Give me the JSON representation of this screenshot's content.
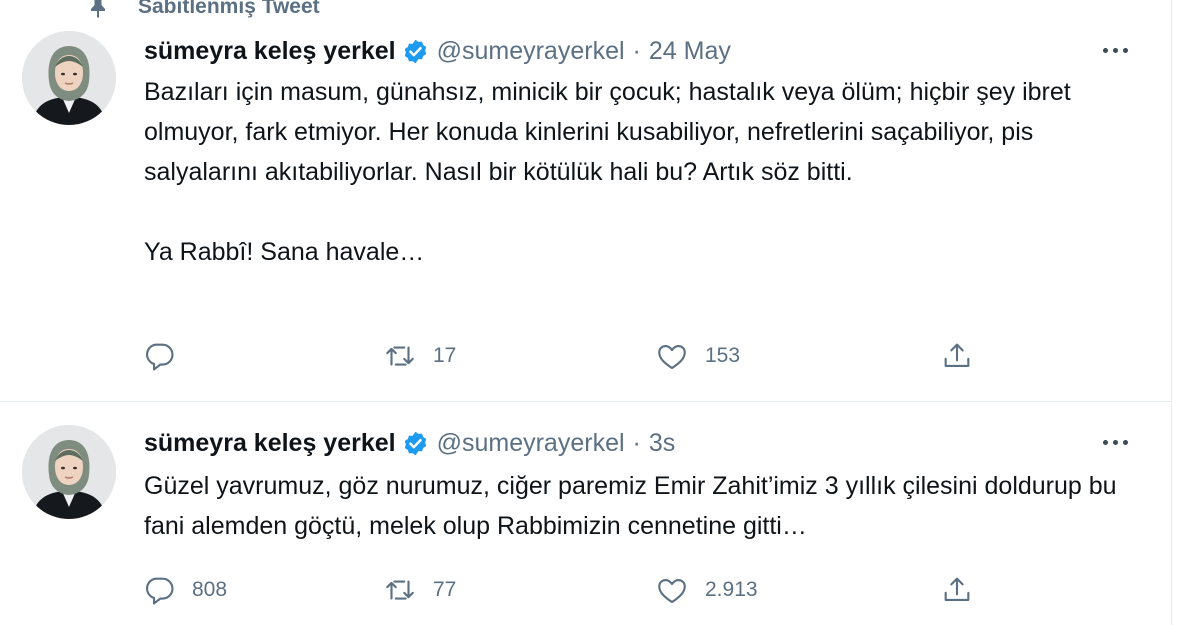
{
  "pinned_label": "Sabitlenmiş Tweet",
  "colors": {
    "verified": "#1d9bf0",
    "secondary_text": "#5b7083",
    "primary_text": "#0f1419",
    "divider": "#e6ecf0"
  },
  "tweets": [
    {
      "display_name": "sümeyra keleş yerkel",
      "handle": "@sumeyrayerkel",
      "separator": "·",
      "time": "24 May",
      "paragraphs": [
        "Bazıları için masum, günahsız, minicik bir çocuk; hastalık veya ölüm; hiçbir şey ibret olmuyor, fark etmiyor. Her konuda kinlerini kusabiliyor, nefretlerini saçabiliyor, pis salyalarını akıtabiliyorlar. Nasıl bir kötülük hali bu? Artık söz bitti.",
        "Ya Rabbî! Sana havale…"
      ],
      "replies": "",
      "retweets": "17",
      "likes": "153",
      "icons": [
        "reply-icon",
        "retweet-icon",
        "like-icon",
        "share-icon"
      ]
    },
    {
      "display_name": "sümeyra keleş yerkel",
      "handle": "@sumeyrayerkel",
      "separator": "·",
      "time": "3s",
      "paragraphs": [
        "Güzel yavrumuz, göz nurumuz, ciğer paremiz Emir Zahit’imiz 3 yıllık çilesini doldurup bu fani alemden göçtü, melek olup Rabbimizin cennetine gitti…"
      ],
      "replies": "808",
      "retweets": "77",
      "likes": "2.913",
      "icons": [
        "reply-icon",
        "retweet-icon",
        "like-icon",
        "share-icon"
      ]
    }
  ]
}
